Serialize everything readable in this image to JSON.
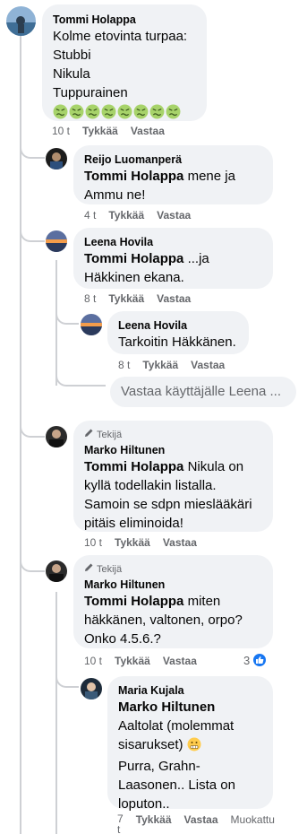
{
  "comments": [
    {
      "author": "Tommi Holappa",
      "lines": [
        "Kolme etovinta turpaa:",
        "Stubbi",
        "Nikula",
        "Tuppurainen"
      ],
      "emoji_count": 8,
      "emoji_name": "nauseated-face-emoji",
      "time": "10 t",
      "like": "Tykkää",
      "reply": "Vastaa"
    },
    {
      "author": "Reijo Luomanperä",
      "mention": "Tommi Holappa",
      "text": " mene ja",
      "text2": "Ammu ne!",
      "time": "4 t",
      "like": "Tykkää",
      "reply": "Vastaa"
    },
    {
      "author": "Leena Hovila",
      "mention": "Tommi Holappa",
      "text": " ...ja",
      "text2": "Häkkinen ekana.",
      "time": "8 t",
      "like": "Tykkää",
      "reply": "Vastaa"
    },
    {
      "author": "Leena Hovila",
      "text": "Tarkoitin Häkkänen.",
      "time": "8 t",
      "like": "Tykkää",
      "reply": "Vastaa"
    },
    {
      "tag": "Tekijä",
      "author": "Marko Hiltunen",
      "mention": "Tommi Holappa",
      "text": " Nikula on",
      "lines": [
        "kyllä todellakin listalla.",
        "Samoin se sdpn mieslääkäri",
        "pitäis eliminoida!"
      ],
      "time": "10 t",
      "like": "Tykkää",
      "reply": "Vastaa"
    },
    {
      "tag": "Tekijä",
      "author": "Marko Hiltunen",
      "mention": "Tommi Holappa",
      "text": " miten",
      "lines": [
        "häkkänen, valtonen, orpo?",
        "Onko 4.5.6.?"
      ],
      "time": "10 t",
      "like": "Tykkää",
      "reply": "Vastaa",
      "reaction_count": "3"
    },
    {
      "author": "Maria Kujala",
      "mention": "Marko Hiltunen",
      "lines": [
        "Aaltolat (molemmat",
        "sisarukset) ",
        "Purra, Grahn-",
        "Laasonen.. Lista on",
        "loputon.."
      ],
      "time": "7",
      "time_cont": "t",
      "like": "Tykkää",
      "reply": "Vastaa",
      "edit": "Muokattu"
    }
  ],
  "reply_input": {
    "placeholder": "Vastaa käyttäjälle Leena ..."
  },
  "colors": {
    "bubble": "#f0f2f5",
    "line": "#ced0d4",
    "meta": "#65676b",
    "like_blue": "#1877f2"
  }
}
